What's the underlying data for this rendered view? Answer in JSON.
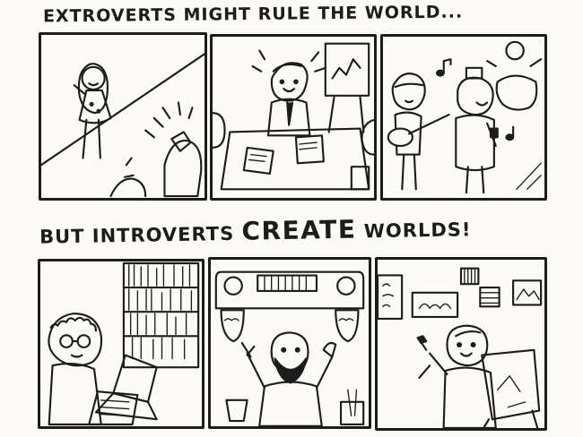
{
  "captions": {
    "top": "EXTROVERTS MIGHT RULE THE WORLD...",
    "bottom_prefix": "BUT INTROVERTS ",
    "bottom_emphasis": "CREATE",
    "bottom_suffix": " WORLDS!"
  },
  "panels": {
    "top": [
      {
        "scene": "speaker-on-stage"
      },
      {
        "scene": "boss-at-meeting"
      },
      {
        "scene": "band-performing"
      }
    ],
    "bottom": [
      {
        "scene": "writer-at-laptop"
      },
      {
        "scene": "bearded-inventor"
      },
      {
        "scene": "painter-at-easel"
      }
    ]
  }
}
